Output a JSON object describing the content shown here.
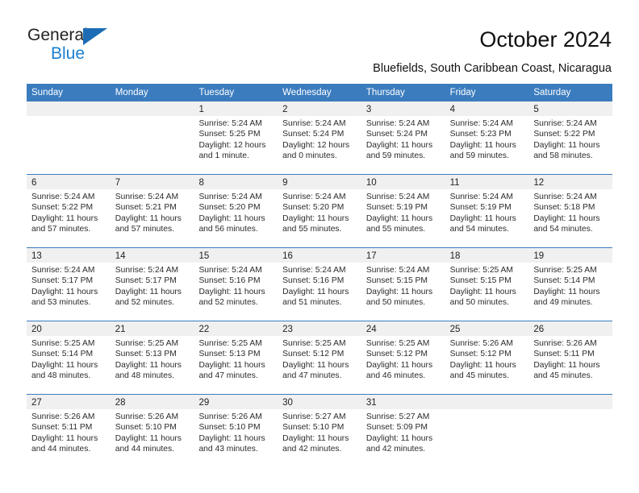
{
  "brand": {
    "line1": "General",
    "line2": "Blue",
    "triangle_color": "#1b6cb5",
    "blue_text_color": "#1c7fd0"
  },
  "header": {
    "title": "October 2024",
    "subtitle": "Bluefields, South Caribbean Coast, Nicaragua"
  },
  "colors": {
    "header_blue": "#3b7cbe",
    "daynum_band": "#f0f0f0",
    "text": "#2b2b2b"
  },
  "calendar": {
    "weekdays": [
      "Sunday",
      "Monday",
      "Tuesday",
      "Wednesday",
      "Thursday",
      "Friday",
      "Saturday"
    ],
    "weeks": [
      [
        {
          "day": "",
          "sunrise": "",
          "sunset": "",
          "daylight1": "",
          "daylight2": ""
        },
        {
          "day": "",
          "sunrise": "",
          "sunset": "",
          "daylight1": "",
          "daylight2": ""
        },
        {
          "day": "1",
          "sunrise": "Sunrise: 5:24 AM",
          "sunset": "Sunset: 5:25 PM",
          "daylight1": "Daylight: 12 hours",
          "daylight2": "and 1 minute."
        },
        {
          "day": "2",
          "sunrise": "Sunrise: 5:24 AM",
          "sunset": "Sunset: 5:24 PM",
          "daylight1": "Daylight: 12 hours",
          "daylight2": "and 0 minutes."
        },
        {
          "day": "3",
          "sunrise": "Sunrise: 5:24 AM",
          "sunset": "Sunset: 5:24 PM",
          "daylight1": "Daylight: 11 hours",
          "daylight2": "and 59 minutes."
        },
        {
          "day": "4",
          "sunrise": "Sunrise: 5:24 AM",
          "sunset": "Sunset: 5:23 PM",
          "daylight1": "Daylight: 11 hours",
          "daylight2": "and 59 minutes."
        },
        {
          "day": "5",
          "sunrise": "Sunrise: 5:24 AM",
          "sunset": "Sunset: 5:22 PM",
          "daylight1": "Daylight: 11 hours",
          "daylight2": "and 58 minutes."
        }
      ],
      [
        {
          "day": "6",
          "sunrise": "Sunrise: 5:24 AM",
          "sunset": "Sunset: 5:22 PM",
          "daylight1": "Daylight: 11 hours",
          "daylight2": "and 57 minutes."
        },
        {
          "day": "7",
          "sunrise": "Sunrise: 5:24 AM",
          "sunset": "Sunset: 5:21 PM",
          "daylight1": "Daylight: 11 hours",
          "daylight2": "and 57 minutes."
        },
        {
          "day": "8",
          "sunrise": "Sunrise: 5:24 AM",
          "sunset": "Sunset: 5:20 PM",
          "daylight1": "Daylight: 11 hours",
          "daylight2": "and 56 minutes."
        },
        {
          "day": "9",
          "sunrise": "Sunrise: 5:24 AM",
          "sunset": "Sunset: 5:20 PM",
          "daylight1": "Daylight: 11 hours",
          "daylight2": "and 55 minutes."
        },
        {
          "day": "10",
          "sunrise": "Sunrise: 5:24 AM",
          "sunset": "Sunset: 5:19 PM",
          "daylight1": "Daylight: 11 hours",
          "daylight2": "and 55 minutes."
        },
        {
          "day": "11",
          "sunrise": "Sunrise: 5:24 AM",
          "sunset": "Sunset: 5:19 PM",
          "daylight1": "Daylight: 11 hours",
          "daylight2": "and 54 minutes."
        },
        {
          "day": "12",
          "sunrise": "Sunrise: 5:24 AM",
          "sunset": "Sunset: 5:18 PM",
          "daylight1": "Daylight: 11 hours",
          "daylight2": "and 54 minutes."
        }
      ],
      [
        {
          "day": "13",
          "sunrise": "Sunrise: 5:24 AM",
          "sunset": "Sunset: 5:17 PM",
          "daylight1": "Daylight: 11 hours",
          "daylight2": "and 53 minutes."
        },
        {
          "day": "14",
          "sunrise": "Sunrise: 5:24 AM",
          "sunset": "Sunset: 5:17 PM",
          "daylight1": "Daylight: 11 hours",
          "daylight2": "and 52 minutes."
        },
        {
          "day": "15",
          "sunrise": "Sunrise: 5:24 AM",
          "sunset": "Sunset: 5:16 PM",
          "daylight1": "Daylight: 11 hours",
          "daylight2": "and 52 minutes."
        },
        {
          "day": "16",
          "sunrise": "Sunrise: 5:24 AM",
          "sunset": "Sunset: 5:16 PM",
          "daylight1": "Daylight: 11 hours",
          "daylight2": "and 51 minutes."
        },
        {
          "day": "17",
          "sunrise": "Sunrise: 5:24 AM",
          "sunset": "Sunset: 5:15 PM",
          "daylight1": "Daylight: 11 hours",
          "daylight2": "and 50 minutes."
        },
        {
          "day": "18",
          "sunrise": "Sunrise: 5:25 AM",
          "sunset": "Sunset: 5:15 PM",
          "daylight1": "Daylight: 11 hours",
          "daylight2": "and 50 minutes."
        },
        {
          "day": "19",
          "sunrise": "Sunrise: 5:25 AM",
          "sunset": "Sunset: 5:14 PM",
          "daylight1": "Daylight: 11 hours",
          "daylight2": "and 49 minutes."
        }
      ],
      [
        {
          "day": "20",
          "sunrise": "Sunrise: 5:25 AM",
          "sunset": "Sunset: 5:14 PM",
          "daylight1": "Daylight: 11 hours",
          "daylight2": "and 48 minutes."
        },
        {
          "day": "21",
          "sunrise": "Sunrise: 5:25 AM",
          "sunset": "Sunset: 5:13 PM",
          "daylight1": "Daylight: 11 hours",
          "daylight2": "and 48 minutes."
        },
        {
          "day": "22",
          "sunrise": "Sunrise: 5:25 AM",
          "sunset": "Sunset: 5:13 PM",
          "daylight1": "Daylight: 11 hours",
          "daylight2": "and 47 minutes."
        },
        {
          "day": "23",
          "sunrise": "Sunrise: 5:25 AM",
          "sunset": "Sunset: 5:12 PM",
          "daylight1": "Daylight: 11 hours",
          "daylight2": "and 47 minutes."
        },
        {
          "day": "24",
          "sunrise": "Sunrise: 5:25 AM",
          "sunset": "Sunset: 5:12 PM",
          "daylight1": "Daylight: 11 hours",
          "daylight2": "and 46 minutes."
        },
        {
          "day": "25",
          "sunrise": "Sunrise: 5:26 AM",
          "sunset": "Sunset: 5:12 PM",
          "daylight1": "Daylight: 11 hours",
          "daylight2": "and 45 minutes."
        },
        {
          "day": "26",
          "sunrise": "Sunrise: 5:26 AM",
          "sunset": "Sunset: 5:11 PM",
          "daylight1": "Daylight: 11 hours",
          "daylight2": "and 45 minutes."
        }
      ],
      [
        {
          "day": "27",
          "sunrise": "Sunrise: 5:26 AM",
          "sunset": "Sunset: 5:11 PM",
          "daylight1": "Daylight: 11 hours",
          "daylight2": "and 44 minutes."
        },
        {
          "day": "28",
          "sunrise": "Sunrise: 5:26 AM",
          "sunset": "Sunset: 5:10 PM",
          "daylight1": "Daylight: 11 hours",
          "daylight2": "and 44 minutes."
        },
        {
          "day": "29",
          "sunrise": "Sunrise: 5:26 AM",
          "sunset": "Sunset: 5:10 PM",
          "daylight1": "Daylight: 11 hours",
          "daylight2": "and 43 minutes."
        },
        {
          "day": "30",
          "sunrise": "Sunrise: 5:27 AM",
          "sunset": "Sunset: 5:10 PM",
          "daylight1": "Daylight: 11 hours",
          "daylight2": "and 42 minutes."
        },
        {
          "day": "31",
          "sunrise": "Sunrise: 5:27 AM",
          "sunset": "Sunset: 5:09 PM",
          "daylight1": "Daylight: 11 hours",
          "daylight2": "and 42 minutes."
        },
        {
          "day": "",
          "sunrise": "",
          "sunset": "",
          "daylight1": "",
          "daylight2": ""
        },
        {
          "day": "",
          "sunrise": "",
          "sunset": "",
          "daylight1": "",
          "daylight2": ""
        }
      ]
    ]
  }
}
